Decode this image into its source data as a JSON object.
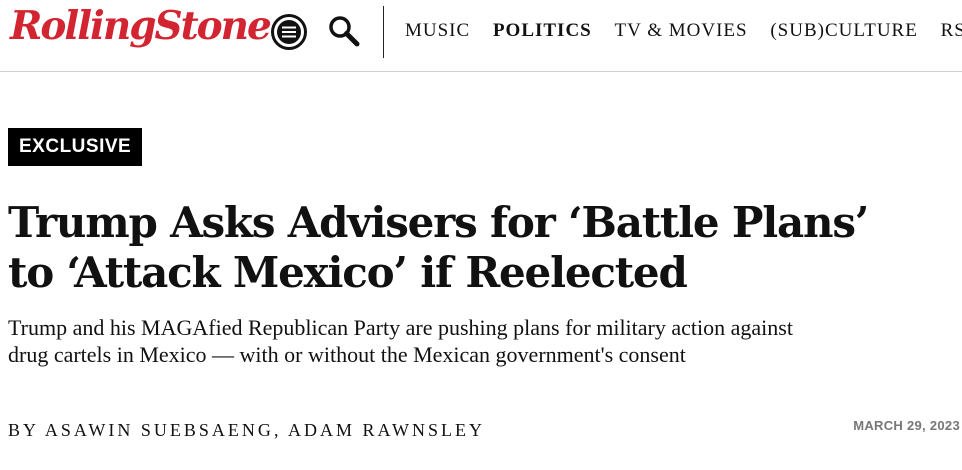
{
  "header": {
    "logo_text": "RollingStone",
    "menu_icon": "hamburger-menu-icon",
    "search_icon": "search-icon",
    "nav": [
      {
        "label": "MUSIC"
      },
      {
        "label": "POLITICS",
        "active": true
      },
      {
        "label": "TV & MOVIES"
      },
      {
        "label": "(SUB)CULTURE"
      },
      {
        "label": "RS"
      }
    ]
  },
  "article": {
    "badge": "EXCLUSIVE",
    "headline": "Trump Asks Advisers for ‘Battle Plans’ to ‘Attack Mexico’ if Reelected",
    "dek": "Trump and his MAGAfied Republican Party are pushing plans for military action against drug cartels in Mexico — with or without the Mexican government's consent",
    "byline_prefix": "BY",
    "authors": [
      "ASAWIN SUEBSAENG",
      "ADAM RAWNSLEY"
    ],
    "author_separator": ",",
    "date": "MARCH 29, 2023"
  },
  "colors": {
    "brand": "#d32531",
    "text": "#111111",
    "badge_bg": "#000000",
    "date": "#777777"
  }
}
